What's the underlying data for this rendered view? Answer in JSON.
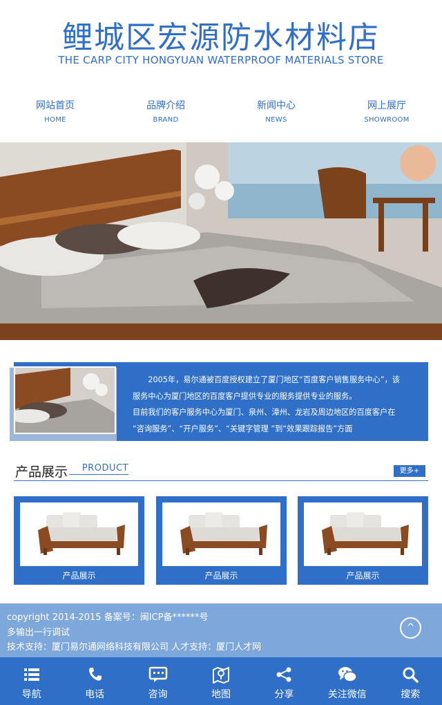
{
  "header": {
    "title": "鲤城区宏源防水材料店",
    "subtitle": "THE CARP CITY HONGYUAN WATERPROOF MATERIALS STORE"
  },
  "nav": [
    {
      "cn": "网站首页",
      "en": "HOME"
    },
    {
      "cn": "品牌介绍",
      "en": "BRAND"
    },
    {
      "cn": "新闻中心",
      "en": "NEWS"
    },
    {
      "cn": "网上展厅",
      "en": "SHOWROOM"
    }
  ],
  "about": {
    "lines": [
      "　　2005年，易尔通被百度授权建立了厦门地区“百度客户销售服务中心”，该",
      "服务中心为厦门地区的百度客户提供专业的服务提供专业的服务。",
      "目前我们的客户服务中心为厦门、泉州、漳州、龙岩及周边地区的百度客户在",
      "“咨询服务”、“开户服务”、“关键字管理 ”到“效果跟踪报告”方面"
    ]
  },
  "products_section": {
    "title": "产品展示",
    "title_en": "PRODUCT",
    "more_label": "更多+",
    "items": [
      {
        "name": "产品展示"
      },
      {
        "name": "产品展示"
      },
      {
        "name": "产品展示"
      }
    ]
  },
  "footer": {
    "copyright": "copyright 2014-2015 备案号：闽ICP备******号",
    "line2": "多输出一行调试",
    "support": "技术支持：厦门易尔通网络科技有限公司 人才支持：厦门人才网",
    "back_top": "^"
  },
  "bottom_bar": [
    {
      "label": "导航",
      "icon": "menu-icon"
    },
    {
      "label": "电话",
      "icon": "phone-icon"
    },
    {
      "label": "咨询",
      "icon": "chat-icon"
    },
    {
      "label": "地图",
      "icon": "map-icon"
    },
    {
      "label": "分享",
      "icon": "share-icon"
    },
    {
      "label": "关注微信",
      "icon": "wechat-icon"
    },
    {
      "label": "搜索",
      "icon": "search-icon"
    }
  ],
  "colors": {
    "primary": "#2f6fc7",
    "footer_bg": "#7ea7dc"
  }
}
